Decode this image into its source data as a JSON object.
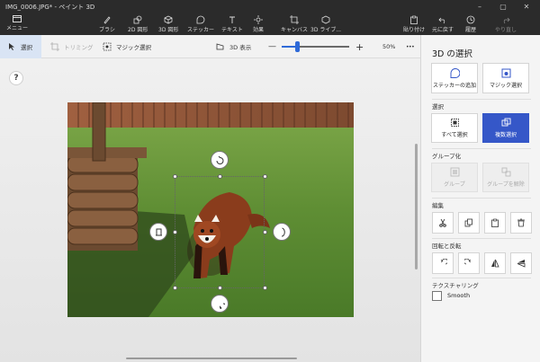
{
  "window": {
    "title": "IMG_0006.JPG* - ペイント 3D",
    "minimize": "–",
    "maximize": "▢",
    "close": "✕"
  },
  "ribbon": {
    "menu_label": "メニュー",
    "tools": [
      {
        "label": "ブラシ",
        "icon": "brush-icon"
      },
      {
        "label": "2D 図形",
        "icon": "2d-shapes-icon"
      },
      {
        "label": "3D 図形",
        "icon": "3d-shapes-icon"
      },
      {
        "label": "ステッカー",
        "icon": "stickers-icon"
      },
      {
        "label": "テキスト",
        "icon": "text-icon"
      },
      {
        "label": "効果",
        "icon": "effects-icon"
      },
      {
        "label": "キャンバス",
        "icon": "canvas-icon"
      },
      {
        "label": "3D ライブ...",
        "icon": "3d-library-icon"
      }
    ],
    "right_tools": [
      {
        "label": "貼り付け",
        "icon": "paste-icon"
      },
      {
        "label": "元に戻す",
        "icon": "undo-icon"
      },
      {
        "label": "履歴",
        "icon": "history-icon"
      },
      {
        "label": "やり直し",
        "icon": "redo-icon"
      }
    ]
  },
  "toolbar2": {
    "select_label": "選択",
    "crop_label": "トリミング",
    "magic_select_label": "マジック選択",
    "view3d_label": "3D 表示",
    "zoom_minus": "—",
    "zoom_plus": "+",
    "zoom_value": "50%",
    "more": "•••",
    "zoom_fraction": 0.22
  },
  "canvas": {
    "help_label": "?"
  },
  "panel": {
    "title": "3D の選択",
    "add_sticker_label": "ステッカーの追加",
    "magic_select_label": "マジック選択",
    "select_section": "選択",
    "select_all_label": "すべて選択",
    "multi_select_label": "複数選択",
    "group_section": "グループ化",
    "group_label": "グループ",
    "ungroup_label": "グループを解除",
    "edit_section": "編集",
    "rotate_section": "回転と反転",
    "texturing_section": "テクスチャリング",
    "smooth_label": "Smooth"
  },
  "colors": {
    "accent": "#3557c8",
    "ribbon_bg": "#2b2b2b",
    "selected_tab": "#d9e4f4"
  }
}
